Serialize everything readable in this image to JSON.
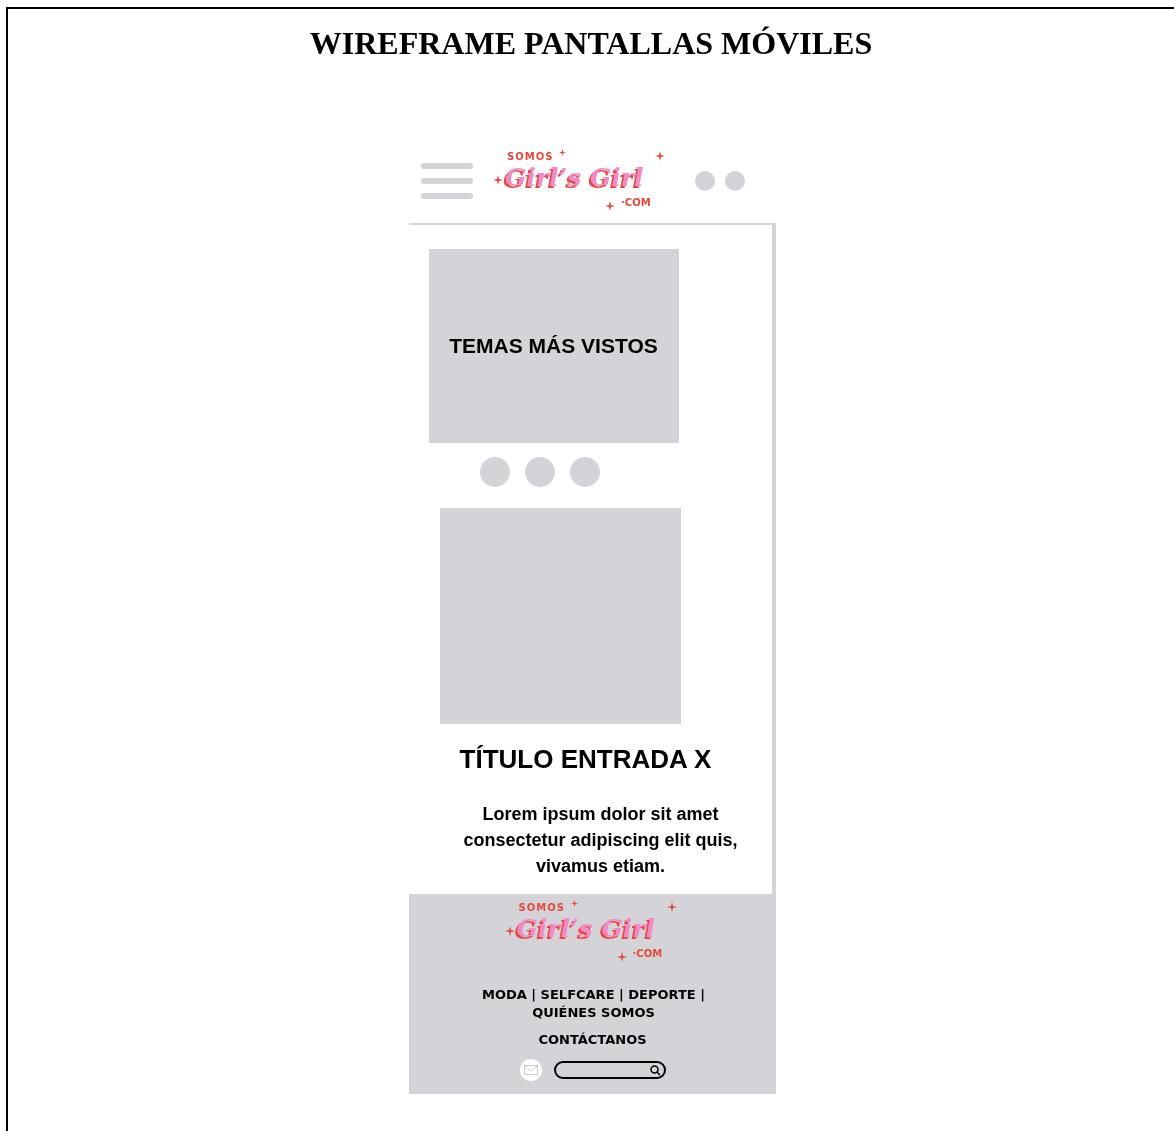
{
  "document": {
    "title": "WIREFRAME PANTALLAS MÓVILES"
  },
  "header": {
    "logo": {
      "top": "SOMOS",
      "main": "Girl’s Girl",
      "bottom": "·COM"
    }
  },
  "featured": {
    "label": "TEMAS MÁS VISTOS"
  },
  "carousel_dots": [
    {
      "selected": false
    },
    {
      "selected": false
    },
    {
      "selected": false
    }
  ],
  "post": {
    "title": "TÍTULO ENTRADA X",
    "excerpt": "Lorem ipsum dolor sit amet consectetur adipiscing elit quis, vivamus etiam."
  },
  "footer": {
    "logo": {
      "top": "SOMOS",
      "main": "Girl’s Girl",
      "bottom": "·COM"
    },
    "nav": "MODA | SELFCARE | DEPORTE | QUIÉNES SOMOS",
    "contact": "CONTÁCTANOS"
  }
}
